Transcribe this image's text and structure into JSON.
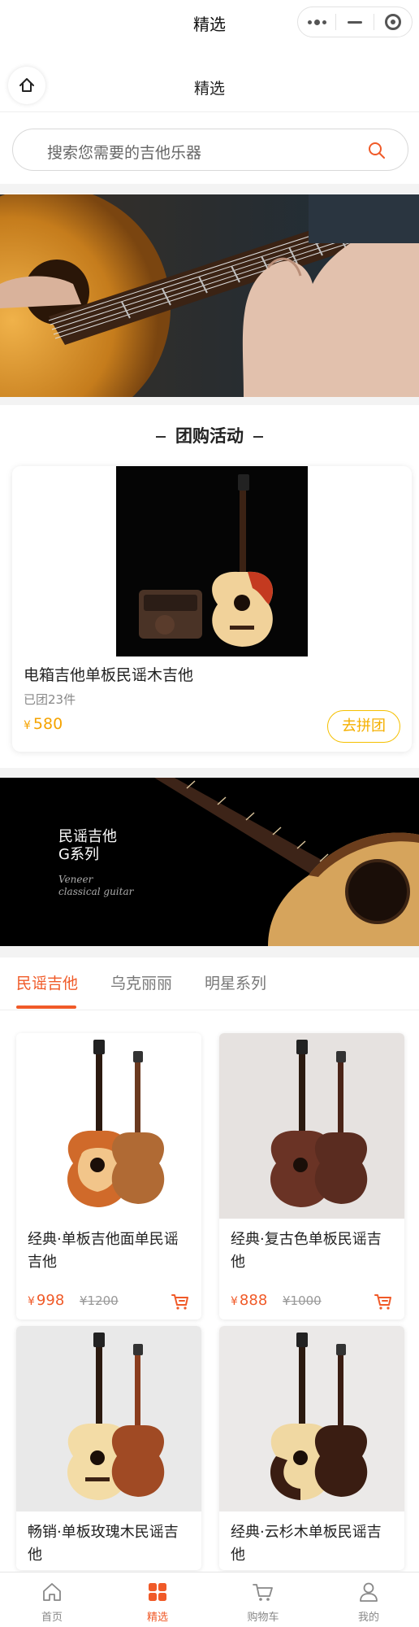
{
  "topbar": {
    "title": "精选"
  },
  "navbar": {
    "title": "精选"
  },
  "search": {
    "placeholder": "搜索您需要的吉他乐器"
  },
  "section": {
    "group_title": "团购活动"
  },
  "group_buy": {
    "name": "电箱吉他单板民谣木吉他",
    "sold": "已团23件",
    "currency": "¥",
    "price": "580",
    "button": "去拼团"
  },
  "banner2": {
    "line1": "民谣吉他",
    "line2": "G系列",
    "line3": "Veneer",
    "line4": "classical guitar"
  },
  "tabs": [
    {
      "label": "民谣吉他",
      "active": true
    },
    {
      "label": "乌克丽丽",
      "active": false
    },
    {
      "label": "明星系列",
      "active": false
    }
  ],
  "products": [
    {
      "name": "经典·单板吉他面单民谣吉他",
      "currency": "¥",
      "price": "998",
      "old_price": "¥1200"
    },
    {
      "name": "经典·复古色单板民谣吉他",
      "currency": "¥",
      "price": "888",
      "old_price": "¥1000"
    },
    {
      "name": "畅销·单板玫瑰木民谣吉他",
      "currency": "¥",
      "price": "",
      "old_price": ""
    },
    {
      "name": "经典·云杉木单板民谣吉他",
      "currency": "¥",
      "price": "",
      "old_price": ""
    }
  ],
  "tabbar": [
    {
      "label": "首页",
      "icon": "home-icon",
      "active": false
    },
    {
      "label": "精选",
      "icon": "grid-icon",
      "active": true
    },
    {
      "label": "购物车",
      "icon": "cart-icon",
      "active": false
    },
    {
      "label": "我的",
      "icon": "user-icon",
      "active": false
    }
  ],
  "colors": {
    "accent": "#f05a28",
    "group_price": "#f5a300"
  }
}
